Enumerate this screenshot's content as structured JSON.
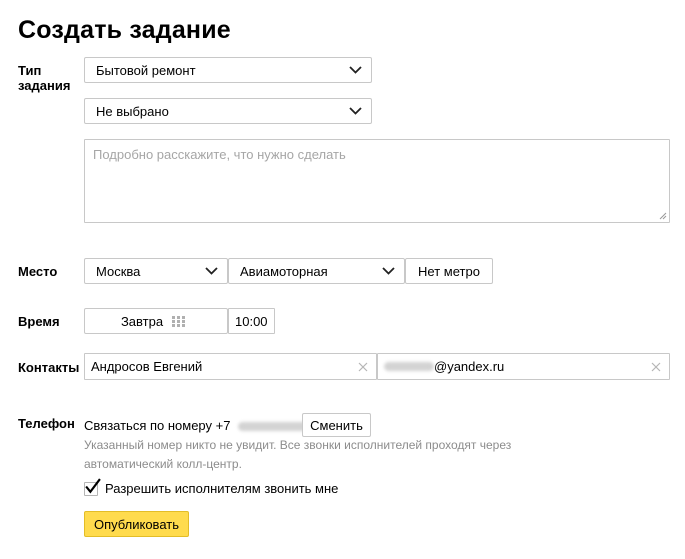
{
  "page": {
    "title": "Создать задание"
  },
  "task_type": {
    "label_line1": "Тип",
    "label_line2": "задания",
    "category": "Бытовой ремонт",
    "subcategory": "Не выбрано",
    "description_placeholder": "Подробно расскажите, что нужно сделать"
  },
  "place": {
    "label": "Место",
    "city": "Москва",
    "street": "Авиамоторная",
    "metro_button": "Нет метро"
  },
  "time": {
    "label": "Время",
    "date": "Завтра",
    "time_value": "10:00"
  },
  "contacts": {
    "label": "Контакты",
    "name": "Андросов Евгений",
    "email_suffix": "@yandex.ru"
  },
  "phone": {
    "label": "Телефон",
    "call_text": "Связаться по номеру +7",
    "change_button": "Сменить",
    "hint": "Указанный номер никто не увидит. Все звонки исполнителей проходят через автоматический колл-центр.",
    "allow_calls_label": "Разрешить исполнителям звонить мне",
    "allow_calls_checked": true
  },
  "actions": {
    "publish": "Опубликовать"
  },
  "colors": {
    "publish_bg": "#ffdb4d",
    "border": "#c8c8c8",
    "hint_text": "#8c8c8c"
  }
}
